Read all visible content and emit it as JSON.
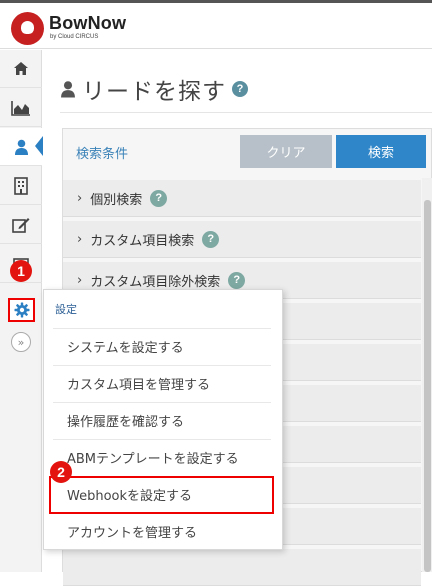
{
  "app": {
    "name": "BowNow",
    "sub": "by Cloud CIRCUS"
  },
  "sidebar": {
    "items": [
      {
        "icon": "home-icon"
      },
      {
        "icon": "chart-icon"
      },
      {
        "icon": "person-icon",
        "active": true
      },
      {
        "icon": "building-icon"
      },
      {
        "icon": "edit-icon"
      },
      {
        "icon": "mail-icon"
      },
      {
        "icon": "gear-icon"
      }
    ],
    "expand_label": "»"
  },
  "page": {
    "title": "リードを探す",
    "help": "?"
  },
  "search": {
    "conditions_label": "検索条件",
    "clear_label": "クリア",
    "search_label": "検索"
  },
  "accordion": [
    {
      "label": "個別検索"
    },
    {
      "label": "カスタム項目検索"
    },
    {
      "label": "カスタム項目除外検索"
    }
  ],
  "settings_menu": {
    "header": "設定",
    "items": [
      "システムを設定する",
      "カスタム項目を管理する",
      "操作履歴を確認する",
      "ABMテンプレートを設定する",
      "Webhookを設定する",
      "アカウントを管理する"
    ]
  },
  "callouts": {
    "one": "1",
    "two": "2"
  },
  "colors": {
    "accent": "#2f86c8",
    "brand": "#c62020",
    "highlight": "#e00000"
  }
}
